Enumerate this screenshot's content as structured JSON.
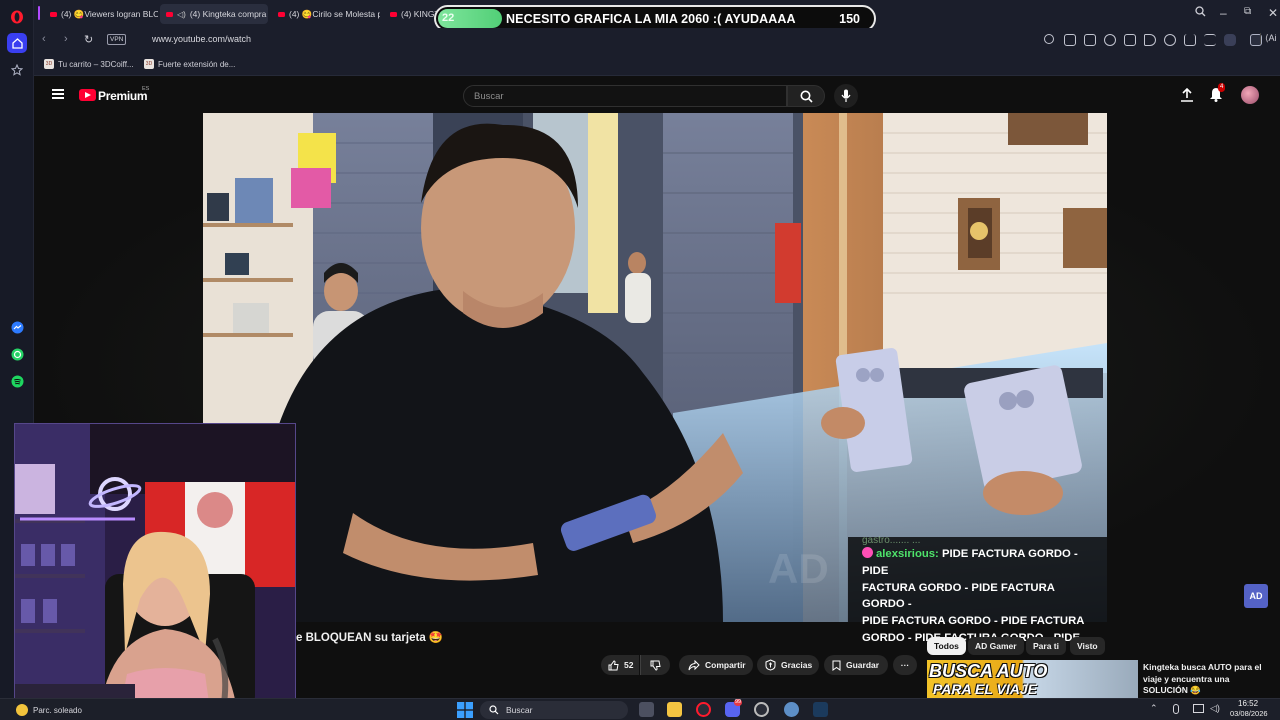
{
  "tabs": [
    {
      "label": "(4) 😋Viewers logran BLO",
      "active": false
    },
    {
      "label": "(4) Kingteka compra 2",
      "active": true
    },
    {
      "label": "(4) 😋Cirilo se Molesta po",
      "active": false
    },
    {
      "label": "(4) KINGT",
      "active": false
    }
  ],
  "overlay": {
    "current": "22",
    "message": "NECESITO GRAFICA LA MIA 2060 :( AYUDAAAA",
    "goal": "150",
    "progress_fraction": 0.147
  },
  "address": {
    "vpn_label": "VPN",
    "url": "www.youtube.com/watch",
    "ai_label": "Ai"
  },
  "bookmarks": [
    {
      "label": "Tu carrito – 3DCoiff...",
      "favicon": "3D"
    },
    {
      "label": "Fuerte extensión de...",
      "favicon": "3D"
    }
  ],
  "youtube": {
    "brand": "Premium",
    "country": "ES",
    "search_placeholder": "Buscar",
    "notifications_count": "4"
  },
  "chat": {
    "cut_line": "gastro....... ...",
    "username": "alexsirious:",
    "message_first": "PIDE FACTURA GORDO - PIDE",
    "message_rest": [
      "FACTURA GORDO - PIDE FACTURA GORDO -",
      "PIDE FACTURA GORDO - PIDE FACTURA",
      "GORDO - PIDE FACTURA GORDO - PIDE"
    ]
  },
  "video": {
    "title": "e BLOQUEAN su tarjeta 🤩",
    "likes": "52",
    "share_label": "Compartir",
    "thanks_label": "Gracias",
    "save_label": "Guardar",
    "more_label": "···"
  },
  "channel_badge": "AD",
  "chips": [
    {
      "label": "Todos",
      "selected": true
    },
    {
      "label": "AD Gamer",
      "selected": false
    },
    {
      "label": "Para ti",
      "selected": false
    },
    {
      "label": "Visto",
      "selected": false
    }
  ],
  "recommended": {
    "thumb_text_line1": "BUSCA AUTO",
    "thumb_text_line2": "PARA EL VIAJE",
    "title_line1": "Kingteka busca AUTO para el",
    "title_line2": "viaje y encuentra una",
    "title_line3": "SOLUCIÓN 😂"
  },
  "taskbar": {
    "weather": "Parc. soleado",
    "search_label": "Buscar",
    "time": "16:52",
    "date": "03/08/2026",
    "discord_badge": "99"
  },
  "colors": {
    "youtube_red": "#ff0033",
    "overlay_green": "#5fd67f",
    "chat_user_green": "#4ee26a",
    "opera_red": "#ff1b2d"
  }
}
